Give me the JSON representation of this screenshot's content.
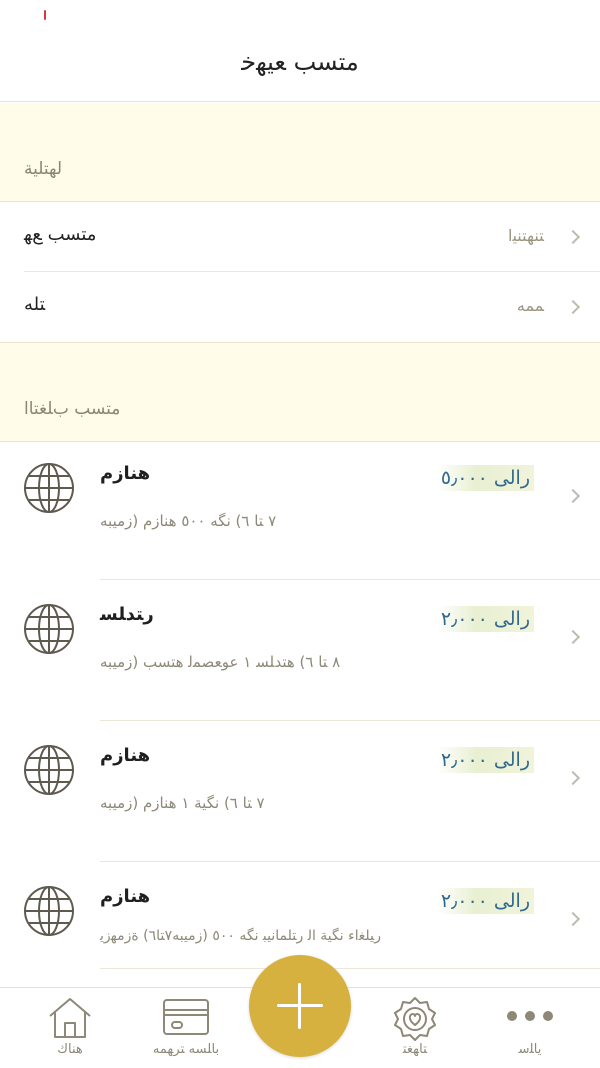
{
  "header": {
    "title": "ﻣﺘﺴﺐ ﻌﻴﻬﺧ"
  },
  "settings": {
    "section_title": "ﻟﻬﺘﻠﻴﺔ",
    "rows": [
      {
        "label": "ﻣﺘﺴﺐ ﻊﻬ",
        "value": "ﺘﻨﻬﺘﻨﻴﺍ"
      },
      {
        "label": "ﺘﻠﻪ",
        "value": "ﻤﻤﻪ"
      }
    ]
  },
  "plans": {
    "section_title": "ﻣﺘﺴﺐ ﺏﻠﻐﺘﺎﺍ",
    "items": [
      {
        "name": "ﻫﻨﺎﺯﻡ",
        "price": "ﺭﺍﻟﻰ ٥٫٠٠٠",
        "desc": "٧ ﺘﺎ ٦) ﻧﮕﻪ ٥٠٠ ﻫﻨﺎﺯﻡ (ﺯﻣﻴﺒﻪ",
        "icon": "globe-icon"
      },
      {
        "name": "ﺭﺘﺪﻠﺴ",
        "price": "ﺭﺍﻟﻰ ٢٫٠٠٠",
        "desc": "٨ ﺘﺎ ٦) ﻫﺘﺪﻠﺴ ١ ﻋﻮﻌﺼﻤﻟ ﻫﺘﺴﺐ (ﺯﻣﻴﺒﻪ",
        "icon": "globe-icon"
      },
      {
        "name": "ﻫﻨﺎﺯﻡ",
        "price": "ﺭﺍﻟﻰ ٢٫٠٠٠",
        "desc": "٧ ﺘﺎ ٦) ﻧﮕﻴﺔ ١ ﻫﻨﺎﺯﻡ (ﺯﻣﻴﺒﻪ",
        "icon": "globe-icon"
      },
      {
        "name": "ﻫﻨﺎﺯﻡ",
        "price": "ﺭﺍﻟﻰ ٢٫٠٠٠",
        "desc": "ﺭﻴﻠﻐﺍﺀ ﻧﮕﻴﺔ ﺍﻟ ﺭﺘﻠﻤﺎﻧﻴﺒ ﻧﮕﻪ ٥٠٠ (ﺯﻣﻴﺒﻪ٧ﺘﺎ٦) ﺓﺯﻣﻬﺯﻳ",
        "icon": "globe-icon"
      }
    ]
  },
  "tabbar": {
    "tabs": [
      {
        "label": "ﻫﻨﺎﻙ",
        "icon": "home-icon"
      },
      {
        "label": "ﺑﺎﻠﺴﻪ ﺘﺮﻬﻤﻪ",
        "icon": "card-icon"
      },
      {
        "label": "ﺘﺎﻬﻐﺘ",
        "icon": "badge-icon"
      },
      {
        "label": "ﻳﺎﻠﺳ",
        "icon": "more-icon"
      }
    ],
    "fab_icon": "plus-icon"
  },
  "colors": {
    "accent": "#d7b13f",
    "section_bg": "#fffcea",
    "price_text": "#2f6a8e",
    "muted_text": "#8d8877"
  }
}
